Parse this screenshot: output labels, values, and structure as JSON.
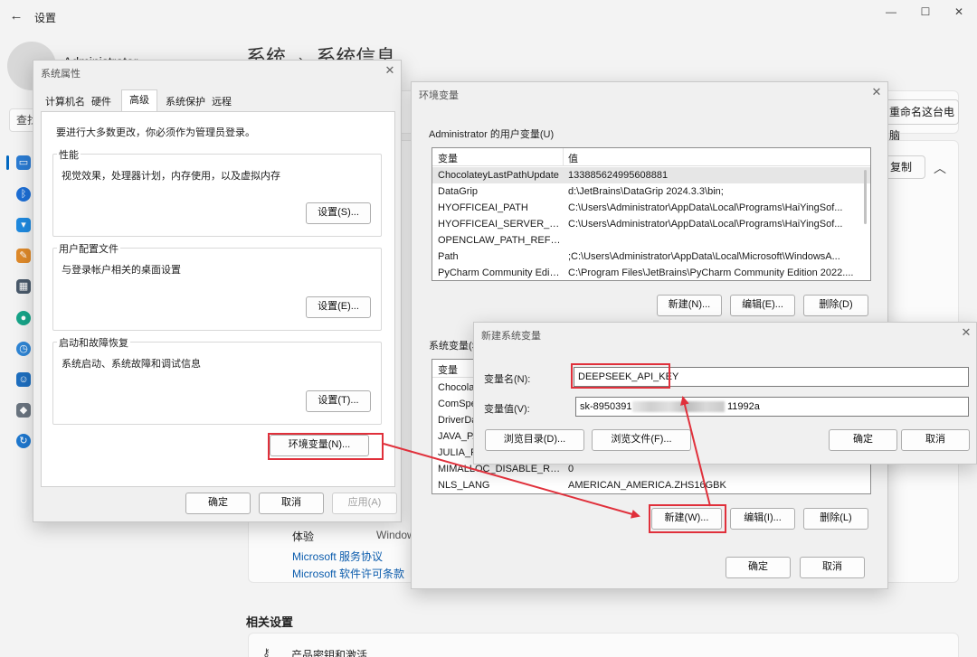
{
  "settings": {
    "title": "设置",
    "user_name": "Administrator",
    "search_text": "查找",
    "breadcrumb_parent": "系统",
    "breadcrumb_sep": "›",
    "breadcrumb_current": "系统信息",
    "rename_button": "重命名这台电脑",
    "copy_button": "复制",
    "experience_label": "体验",
    "experience_value": "Windows",
    "ms_service_link": "Microsoft 服务协议",
    "ms_license_link": "Microsoft 软件许可条款",
    "related_title": "相关设置",
    "related_item": "产品密钥和激活",
    "colors": {
      "accent": "#0067c0",
      "link": "#0b5cad",
      "highlight": "#e0303b"
    }
  },
  "sysprops": {
    "title": "系统属性",
    "tabs": [
      "计算机名",
      "硬件",
      "高级",
      "系统保护",
      "远程"
    ],
    "active_tab": "高级",
    "notice": "要进行大多数更改，你必须作为管理员登录。",
    "groups": [
      {
        "label": "性能",
        "desc": "视觉效果，处理器计划，内存使用，以及虚拟内存",
        "button": "设置(S)..."
      },
      {
        "label": "用户配置文件",
        "desc": "与登录帐户相关的桌面设置",
        "button": "设置(E)..."
      },
      {
        "label": "启动和故障恢复",
        "desc": "系统启动、系统故障和调试信息",
        "button": "设置(T)..."
      }
    ],
    "env_button": "环境变量(N)...",
    "ok": "确定",
    "cancel": "取消",
    "apply": "应用(A)"
  },
  "envvars": {
    "title": "环境变量",
    "user_section": "Administrator 的用户变量(U)",
    "col_var": "变量",
    "col_val": "值",
    "user_vars": [
      {
        "name": "ChocolateyLastPathUpdate",
        "value": "133885624995608881"
      },
      {
        "name": "DataGrip",
        "value": "d:\\JetBrains\\DataGrip 2024.3.3\\bin;"
      },
      {
        "name": "HYOFFICEAI_PATH",
        "value": "C:\\Users\\Administrator\\AppData\\Local\\Programs\\HaiYingSof..."
      },
      {
        "name": "HYOFFICEAI_SERVER_PATH",
        "value": "C:\\Users\\Administrator\\AppData\\Local\\Programs\\HaiYingSof..."
      },
      {
        "name": "OPENCLAW_PATH_REFRE...",
        "value": ""
      },
      {
        "name": "Path",
        "value": ";C:\\Users\\Administrator\\AppData\\Local\\Microsoft\\WindowsA..."
      },
      {
        "name": "PyCharm Community Editi...",
        "value": "C:\\Program Files\\JetBrains\\PyCharm Community Edition 2022...."
      }
    ],
    "user_new": "新建(N)...",
    "user_edit": "编辑(E)...",
    "user_delete": "删除(D)",
    "sys_section": "系统变量(S)",
    "sys_vars": [
      {
        "name": "Chocolat",
        "value": ""
      },
      {
        "name": "ComSpe",
        "value": ""
      },
      {
        "name": "DriverDa",
        "value": ""
      },
      {
        "name": "JAVA_PA",
        "value": ""
      },
      {
        "name": "JULIA_PK",
        "value": ""
      },
      {
        "name": "MIMALLOC_DISABLE_RED...",
        "value": "0"
      },
      {
        "name": "NLS_LANG",
        "value": "AMERICAN_AMERICA.ZHS16GBK"
      }
    ],
    "sys_new": "新建(W)...",
    "sys_edit": "编辑(I)...",
    "sys_delete": "删除(L)",
    "ok": "确定",
    "cancel": "取消"
  },
  "newvar": {
    "title": "新建系统变量",
    "name_label": "变量名(N):",
    "name_value": "DEEPSEEK_API_KEY",
    "value_label": "变量值(V):",
    "value_prefix": "sk-8950391",
    "value_suffix": "11992a",
    "browse_dir": "浏览目录(D)...",
    "browse_file": "浏览文件(F)...",
    "ok": "确定",
    "cancel": "取消"
  }
}
